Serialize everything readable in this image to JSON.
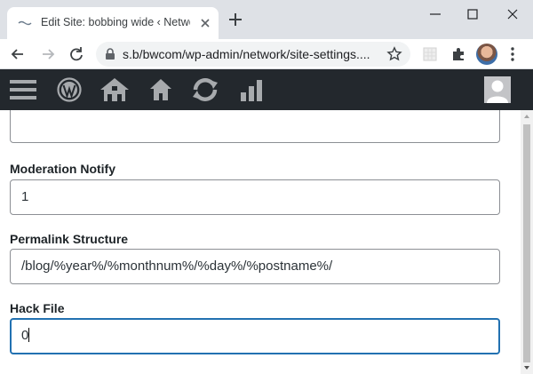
{
  "browser": {
    "tab_title": "Edit Site: bobbing wide ‹ Network",
    "url": "s.b/bwcom/wp-admin/network/site-settings...."
  },
  "colors": {
    "adminbar_bg": "#23282d",
    "focus_border": "#2271b1"
  },
  "adminbar": {
    "icons": [
      "menu-icon",
      "wordpress-logo-icon",
      "my-sites-icon",
      "home-icon",
      "updates-icon",
      "stats-icon",
      "user-avatar-icon"
    ]
  },
  "form": {
    "fields": [
      {
        "label": "",
        "value": ""
      },
      {
        "label": "Moderation Notify",
        "value": "1"
      },
      {
        "label": "Permalink Structure",
        "value": "/blog/%year%/%monthnum%/%day%/%postname%/"
      },
      {
        "label": "Hack File",
        "value": "0"
      }
    ]
  }
}
